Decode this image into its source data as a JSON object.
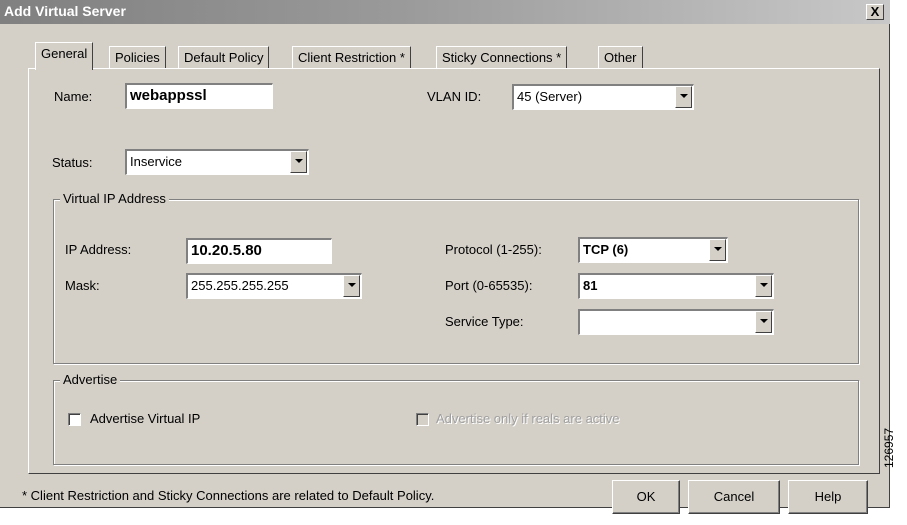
{
  "window": {
    "title": "Add Virtual Server",
    "close_label": "X"
  },
  "tabs": [
    {
      "label": "General",
      "active": true
    },
    {
      "label": "Policies"
    },
    {
      "label": "Default Policy"
    },
    {
      "label": "Client Restriction *"
    },
    {
      "label": "Sticky Connections *"
    },
    {
      "label": "Other"
    }
  ],
  "general": {
    "name_label": "Name:",
    "name_value": "webappssl",
    "vlan_label": "VLAN ID:",
    "vlan_value": "45 (Server)",
    "status_label": "Status:",
    "status_value": "Inservice"
  },
  "vip_group": {
    "title": "Virtual IP Address",
    "ip_label": "IP Address:",
    "ip_value": "10.20.5.80",
    "mask_label": "Mask:",
    "mask_value": "255.255.255.255",
    "protocol_label": "Protocol (1-255):",
    "protocol_value": "TCP (6)",
    "port_label": "Port (0-65535):",
    "port_value": "81",
    "service_type_label": "Service Type:",
    "service_type_value": ""
  },
  "advertise_group": {
    "title": "Advertise",
    "advertise_vip_label": "Advertise Virtual IP",
    "advertise_active_label": "Advertise only if reals are active"
  },
  "footer": {
    "note": "* Client Restriction and Sticky Connections are related to Default Policy.",
    "ok": "OK",
    "cancel": "Cancel",
    "help": "Help"
  },
  "side_code": "126957"
}
